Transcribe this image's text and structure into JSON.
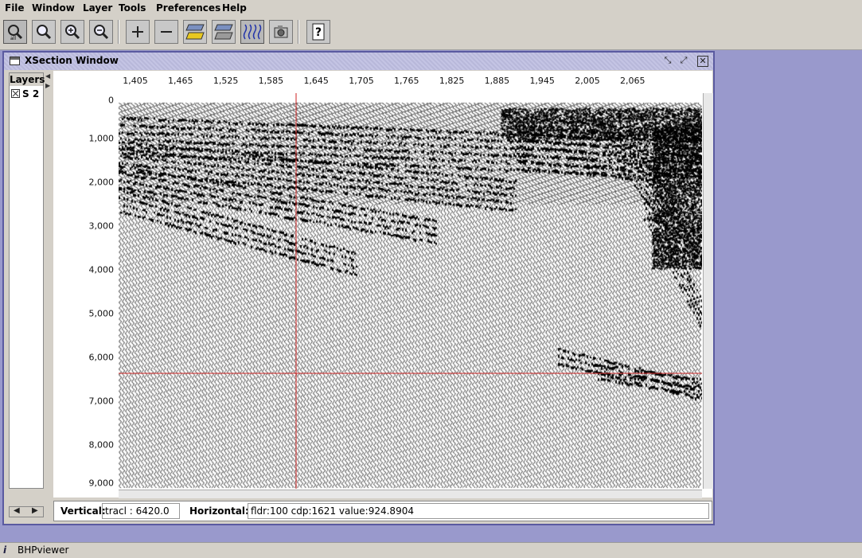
{
  "menu": [
    "File",
    "Window",
    "Layer",
    "Tools",
    "Preferences",
    "Help"
  ],
  "toolbar": {
    "icons": [
      "zoom-all-icon",
      "zoom-icon",
      "zoom-in-icon",
      "zoom-out-icon",
      "plus-icon",
      "minus-icon",
      "layer-yellow-icon",
      "layer-gray-icon",
      "wiggle-trace-icon",
      "snapshot-icon",
      "help-icon"
    ]
  },
  "window": {
    "title": "XSection Window",
    "layers_label": "Layers",
    "layer_item": "S 2"
  },
  "axes": {
    "x_ticks": [
      "1,405",
      "1,465",
      "1,525",
      "1,585",
      "1,645",
      "1,705",
      "1,765",
      "1,825",
      "1,885",
      "1,945",
      "2,005",
      "2,065"
    ],
    "y_ticks": [
      "0",
      "1,000",
      "2,000",
      "3,000",
      "4,000",
      "5,000",
      "6,000",
      "7,000",
      "8,000",
      "9,000"
    ]
  },
  "status": {
    "vertical_label": "Vertical:",
    "vertical_value": "tracl : 6420.0",
    "horizontal_label": "Horizontal:",
    "horizontal_value": "fldr:100 cdp:1621 value:924.8904"
  },
  "bottom": {
    "app_name": "BHPviewer"
  },
  "colors": {
    "crosshair": "#cc2222",
    "desktop": "#9999cc",
    "panel": "#d4d0c8"
  }
}
